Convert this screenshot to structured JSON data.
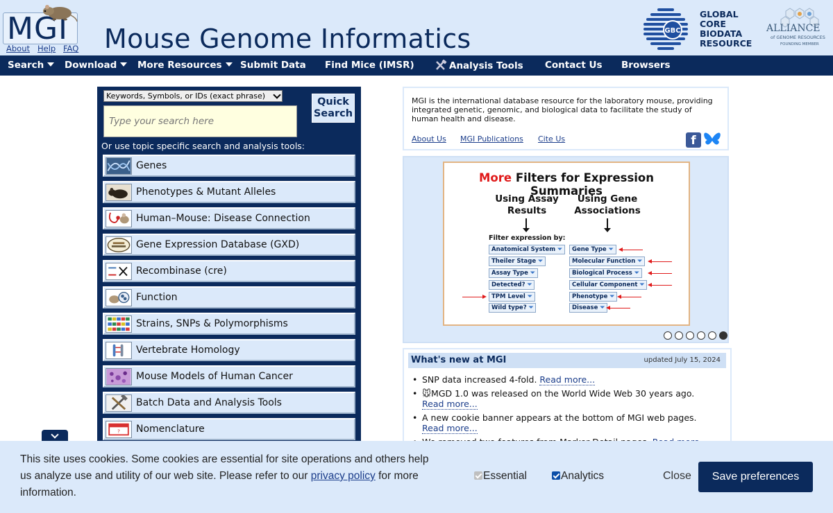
{
  "header": {
    "logo_text": "MGI",
    "links": [
      "About",
      "Help",
      "FAQ"
    ],
    "title": "Mouse Genome Informatics",
    "gbc_lines": [
      "GLOBAL",
      "CORE",
      "BIODATA",
      "RESOURCE"
    ],
    "gbc_badge": "GBC",
    "alliance_title": "ALLIANCE",
    "alliance_sub": "of GENOME RESOURCES",
    "alliance_found": "FOUNDING MEMBER"
  },
  "nav": [
    {
      "label": "Search",
      "dropdown": true
    },
    {
      "label": "Download",
      "dropdown": true
    },
    {
      "label": "More Resources",
      "dropdown": true
    },
    {
      "label": "Submit Data",
      "dropdown": false
    },
    {
      "label": "Find Mice (IMSR)",
      "dropdown": false
    },
    {
      "label": "Analysis Tools",
      "dropdown": false
    },
    {
      "label": "Contact Us",
      "dropdown": false
    },
    {
      "label": "Browsers",
      "dropdown": false
    }
  ],
  "search": {
    "select_value": "Keywords, Symbols, or IDs (exact phrase)",
    "placeholder": "Type your search here",
    "button_label": "Quick Search",
    "topic_label": "Or use topic specific search and analysis tools:",
    "topics": [
      {
        "label": "Genes",
        "icon": "dna-icon"
      },
      {
        "label": "Phenotypes & Mutant Alleles",
        "icon": "mouse-icon"
      },
      {
        "label": "Human–Mouse: Disease Connection",
        "icon": "stethoscope-mouse-icon"
      },
      {
        "label": "Gene Expression Database (GXD)",
        "icon": "gxd-logo-icon"
      },
      {
        "label": "Recombinase (cre)",
        "icon": "recombinase-icon"
      },
      {
        "label": "Function",
        "icon": "function-icon"
      },
      {
        "label": "Strains, SNPs & Polymorphisms",
        "icon": "snp-grid-icon"
      },
      {
        "label": "Vertebrate Homology",
        "icon": "homology-icon"
      },
      {
        "label": "Mouse Models of Human Cancer",
        "icon": "cancer-tissue-icon"
      },
      {
        "label": "Batch Data and Analysis Tools",
        "icon": "tools-icon"
      },
      {
        "label": "Nomenclature",
        "icon": "name-tag-icon"
      }
    ]
  },
  "intro": {
    "text": "MGI is the international database resource for the laboratory mouse, providing integrated genetic, genomic, and biological data to facilitate the study of human health and disease.",
    "links": [
      "About Us",
      "MGI Publications",
      "Cite Us"
    ],
    "fb": "f"
  },
  "slide": {
    "title_highlight": "More",
    "title_rest": " Filters for Expression Summaries",
    "col_left": "Using Assay Results",
    "col_right": "Using Gene Associations",
    "filter_label": "Filter expression by:",
    "left_tags": [
      "Anatomical System",
      "Theiler Stage",
      "Assay Type",
      "Detected?",
      "TPM Level",
      "Wild type?"
    ],
    "right_tags": [
      "Gene Type",
      "Molecular Function",
      "Biological Process",
      "Cellular Component",
      "Phenotype",
      "Disease"
    ],
    "dots": 6,
    "active_dot": 5
  },
  "news": {
    "title": "What's new at MGI",
    "updated": "updated July 15, 2024",
    "items": [
      {
        "text": "SNP data increased 4-fold. ",
        "link": "Read more..."
      },
      {
        "text": "🐭MGD 1.0 was released on the World Wide Web 30 years ago. ",
        "link": "Read more..."
      },
      {
        "text": "A new cookie banner appears at the bottom of MGI web pages. ",
        "link": "Read more..."
      },
      {
        "text": "We removed two features from Marker Detail pages. ",
        "link": "Read more..."
      }
    ]
  },
  "cookie": {
    "text_before": "This site uses cookies. Some cookies are essential for site operations and others help us analyze use and utility of our web site. Please refer to our ",
    "link": "privacy policy",
    "text_after": " for more information.",
    "essential": "Essential",
    "analytics": "Analytics",
    "close": "Close",
    "save": "Save preferences"
  }
}
